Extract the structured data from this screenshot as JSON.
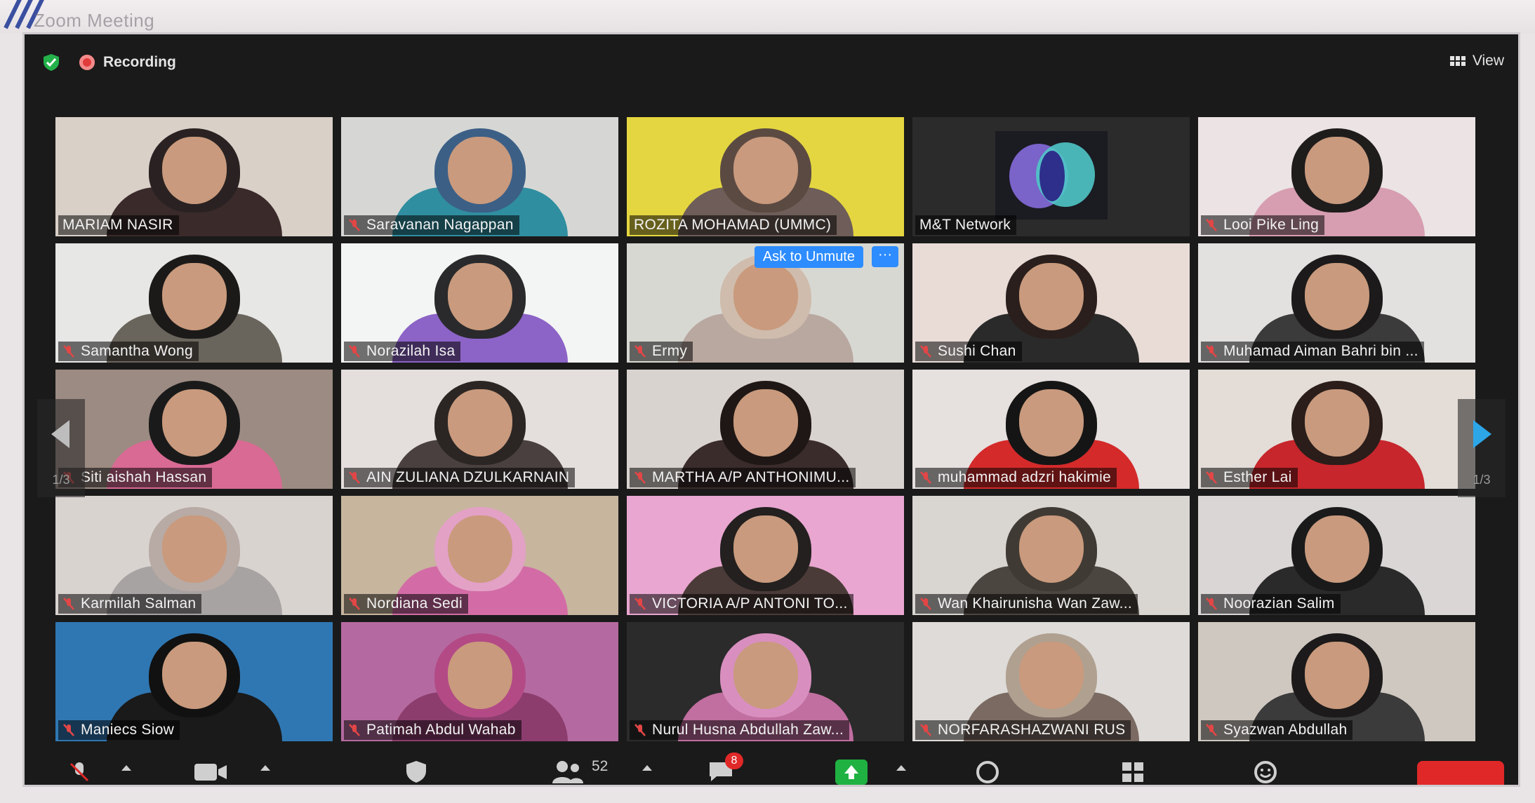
{
  "window": {
    "title": "Zoom Meeting"
  },
  "topbar": {
    "recording_label": "Recording",
    "view_label": "View",
    "icons": [
      "shield-check-icon",
      "recording-dot-icon",
      "grid-view-icon"
    ]
  },
  "colors": {
    "active_speaker_border": "#c8e86a",
    "ask_unmute_bg": "#2d8cff",
    "recording_red": "#e23b3b",
    "share_green": "#1fb141",
    "end_red": "#e02828"
  },
  "participants": [
    {
      "name": "MARIAM NASIR",
      "muted": false,
      "active": true,
      "bg": "#d9d0c8",
      "body": "#3a2a2a",
      "head": "#2a2222"
    },
    {
      "name": "Saravanan Nagappan",
      "muted": true,
      "bg": "#d6d7d4",
      "body": "#2f8ea0",
      "head": "#3c5f86"
    },
    {
      "name": "ROZITA MOHAMAD (UMMC)",
      "muted": false,
      "bg": "#e4d640",
      "body": "#6e5d58",
      "head": "#5b4a42"
    },
    {
      "name": "M&T Network",
      "muted": false,
      "logo": true,
      "bg": "#2b2b2b"
    },
    {
      "name": "Looi Pike Ling",
      "muted": true,
      "bg": "#ebe3e4",
      "body": "#d79db0",
      "head": "#1f1c1c"
    },
    {
      "name": "Samantha Wong",
      "muted": true,
      "bg": "#e7e7e6",
      "body": "#6a655c",
      "head": "#1c1a19"
    },
    {
      "name": "Norazilah Isa",
      "muted": true,
      "bg": "#f3f5f4",
      "body": "#8c63c6",
      "head": "#2a2a2c"
    },
    {
      "name": "Ermy",
      "muted": true,
      "bg": "#d8d8d3",
      "body": "#b9a8a0",
      "head": "#cfbcad",
      "ask_unmute": "Ask to Unmute",
      "more": "···"
    },
    {
      "name": "Sushi Chan",
      "muted": true,
      "bg": "#e9dcd7",
      "body": "#2a2a2a",
      "head": "#2a1f1c"
    },
    {
      "name": "Muhamad Aiman Bahri bin ...",
      "muted": true,
      "bg": "#e3e1df",
      "body": "#3b3b3b",
      "head": "#1c1a1a"
    },
    {
      "name": "Siti aishah Hassan",
      "muted": true,
      "bg": "#9c8b82",
      "body": "#d86a93",
      "head": "#1a1a1a"
    },
    {
      "name": "AIN ZULIANA DZULKARNAIN",
      "muted": true,
      "bg": "#e4dedc",
      "body": "#4a4040",
      "head": "#2b2624"
    },
    {
      "name": "MARTHA A/P ANTHONIMU...",
      "muted": true,
      "bg": "#d9d3cf",
      "body": "#3a2c2a",
      "head": "#1f1715"
    },
    {
      "name": "muhammad adzri hakimie",
      "muted": true,
      "bg": "#e6e0df",
      "body": "#d42a2a",
      "head": "#151515"
    },
    {
      "name": "Esther Lai",
      "muted": true,
      "bg": "#e3dcd7",
      "body": "#c7262c",
      "head": "#2a1d1a"
    },
    {
      "name": "Karmilah Salman",
      "muted": true,
      "bg": "#d9d3d0",
      "body": "#a7a3a2",
      "head": "#b8aaa4"
    },
    {
      "name": "Nordiana Sedi",
      "muted": true,
      "bg": "#c7b59e",
      "body": "#d36ca6",
      "head": "#e3a1c6"
    },
    {
      "name": "VICTORIA A/P ANTONI TO...",
      "muted": true,
      "bg": "#e8a6d0",
      "body": "#4b3b38",
      "head": "#23201f"
    },
    {
      "name": "Wan Khairunisha Wan Zaw...",
      "muted": true,
      "bg": "#d9d6d2",
      "body": "#4c4640",
      "head": "#403a34"
    },
    {
      "name": "Noorazian Salim",
      "muted": true,
      "bg": "#dad6d6",
      "body": "#2a2a2a",
      "head": "#1a1a1a"
    },
    {
      "name": "Maniecs Siow",
      "muted": true,
      "bg": "#2f77b2",
      "body": "#1a1a1a",
      "head": "#111"
    },
    {
      "name": "Patimah Abdul Wahab",
      "muted": true,
      "bg": "#b46aa0",
      "body": "#8c3d6e",
      "head": "#b34a86"
    },
    {
      "name": "Nurul Husna Abdullah Zaw...",
      "muted": true,
      "bg": "#2b2b2b",
      "body": "#c16ea0",
      "head": "#d88fbf"
    },
    {
      "name": "NORFARASHAZWANI RUS",
      "muted": true,
      "bg": "#dedbd8",
      "body": "#7a6a62",
      "head": "#b0a090"
    },
    {
      "name": "Syazwan Abdullah",
      "muted": true,
      "bg": "#cfc8c0",
      "body": "#3b3b3b",
      "head": "#1c1a1a"
    }
  ],
  "pagination": {
    "left_page": "1/3",
    "right_page": "1/3"
  },
  "toolbar": {
    "participants_count": "52",
    "chat_badge": "8",
    "icons": [
      "mute-mic-icon",
      "video-icon",
      "security-shield-icon",
      "participants-icon",
      "chat-icon",
      "share-screen-icon",
      "record-icon",
      "apps-icon",
      "reactions-icon"
    ]
  }
}
